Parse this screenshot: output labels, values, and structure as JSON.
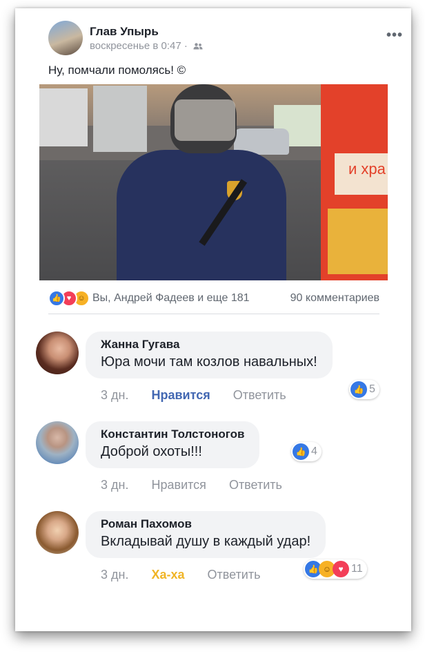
{
  "post": {
    "author": "Глав Упырь",
    "time": "воскресенье в 0:47 ·",
    "audience_icon": "friends-icon",
    "text": "Ну, помчали помолясь! ©",
    "reactions_summary": "Вы, Андрей Фадеев и еще 181",
    "comments_count": "90 комментариев",
    "photo_text": "и хра"
  },
  "comments": [
    {
      "name": "Жанна Гугава",
      "text": "Юра мочи там козлов навальных!",
      "time": "3 дн.",
      "like": "Нравится",
      "reply": "Ответить",
      "reaction_count": "5"
    },
    {
      "name": "Константин Толстоногов",
      "text": "Доброй охоты!!!",
      "time": "3 дн.",
      "like": "Нравится",
      "reply": "Ответить",
      "reaction_count": "4"
    },
    {
      "name": "Роман Пахомов",
      "text": "Вкладывай душу в каждый удар!",
      "time": "3 дн.",
      "like": "Ха-ха",
      "reply": "Ответить",
      "reaction_count": "11"
    }
  ],
  "colors": {
    "like": "#3578e5",
    "love": "#f33e58",
    "haha": "#f7b125",
    "link_blue": "#4267b2",
    "muted": "#90949c"
  }
}
